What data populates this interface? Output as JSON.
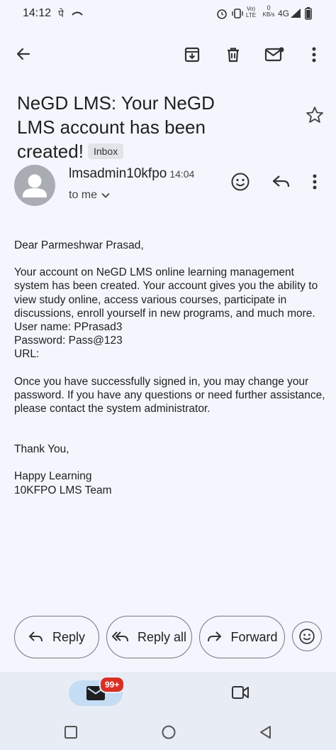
{
  "status_bar": {
    "time": "14:12",
    "extra_icons": "पे",
    "net_speed_value": "0",
    "net_speed_unit": "KB/s",
    "network": "4G",
    "volte": "Vo) LTE"
  },
  "toolbar": {
    "back": "arrow-back-icon",
    "archive": "archive-icon",
    "delete": "delete-icon",
    "mark_unread": "mail-icon",
    "more": "more-vert-icon"
  },
  "email": {
    "subject": "NeGD LMS: Your NeGD LMS account has been created!",
    "label_chip": "Inbox",
    "sender": "lmsadmin10kfpo",
    "time": "14:04",
    "to": "to me",
    "body": {
      "greeting": "Dear Parmeshwar Prasad,",
      "para1": "Your account on NeGD LMS online learning management system has been created. Your account gives you the ability to view study online, access various courses, participate in discussions, enroll yourself in new programs, and much more.",
      "username": "User name: PPrasad3",
      "password": "Password: Pass@123",
      "url": "URL:",
      "para2": "Once you have successfully signed in, you may change your password. If you have any questions or need further assistance, please contact the system administrator.",
      "thanks": "Thank You,",
      "signoff1": "Happy Learning",
      "signoff2": "10KFPO LMS Team"
    }
  },
  "actions": {
    "reply": "Reply",
    "reply_all": "Reply all",
    "forward": "Forward"
  },
  "bottom_nav": {
    "mail_badge": "99+"
  },
  "colors": {
    "background": "#f3f6fc",
    "nav_background": "#e8ecf4",
    "active_pill": "#c4dcf4",
    "badge": "#d93025"
  }
}
